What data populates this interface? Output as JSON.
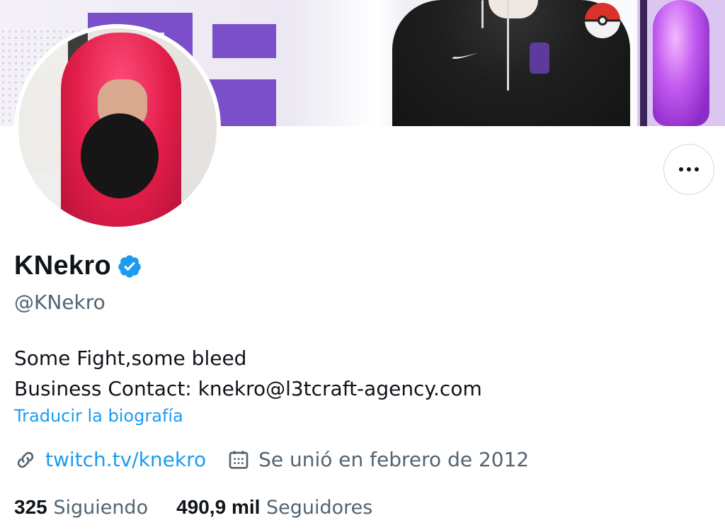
{
  "profile": {
    "display_name": "KNekro",
    "handle": "@KNekro",
    "verified": true,
    "bio_line1": "Some Fight,some bleed",
    "bio_line2": "Business Contact: knekro@l3tcraft-agency.com",
    "translate_label": "Traducir la biografía",
    "website": "twitch.tv/knekro",
    "joined": "Se unió en febrero de 2012"
  },
  "stats": {
    "following_count": "325",
    "following_label": "Siguiendo",
    "followers_count": "490,9 mil",
    "followers_label": "Seguidores"
  },
  "icons": {
    "verified": "verified-badge-icon",
    "more": "more-options-icon",
    "link": "link-icon",
    "calendar": "calendar-icon"
  },
  "colors": {
    "accent": "#1d9bf0",
    "text_primary": "#0f1419",
    "text_secondary": "#536471",
    "border": "#cfd9de"
  }
}
